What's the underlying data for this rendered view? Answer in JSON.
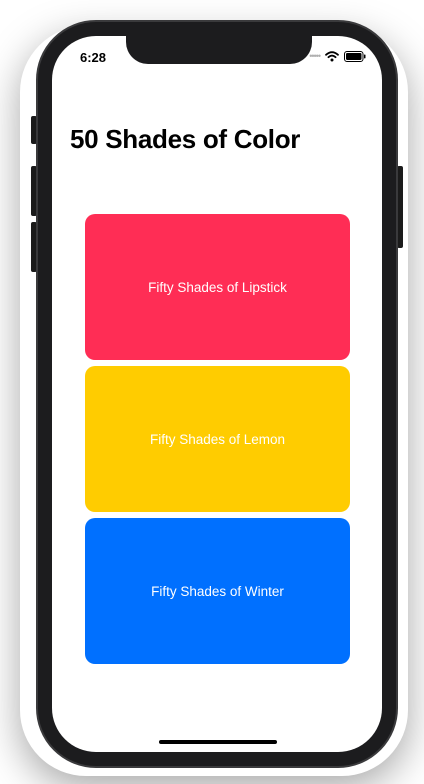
{
  "status_bar": {
    "time": "6:28",
    "signal_icon": "signal-dots-icon",
    "wifi_icon": "wifi-icon",
    "battery_icon": "battery-icon"
  },
  "page": {
    "title": "50 Shades of Color"
  },
  "cards": [
    {
      "label": "Fifty Shades of Lipstick",
      "color": "#FF2D55"
    },
    {
      "label": "Fifty Shades of Lemon",
      "color": "#FFCC00"
    },
    {
      "label": "Fifty Shades of Winter",
      "color": "#0070FF"
    }
  ]
}
